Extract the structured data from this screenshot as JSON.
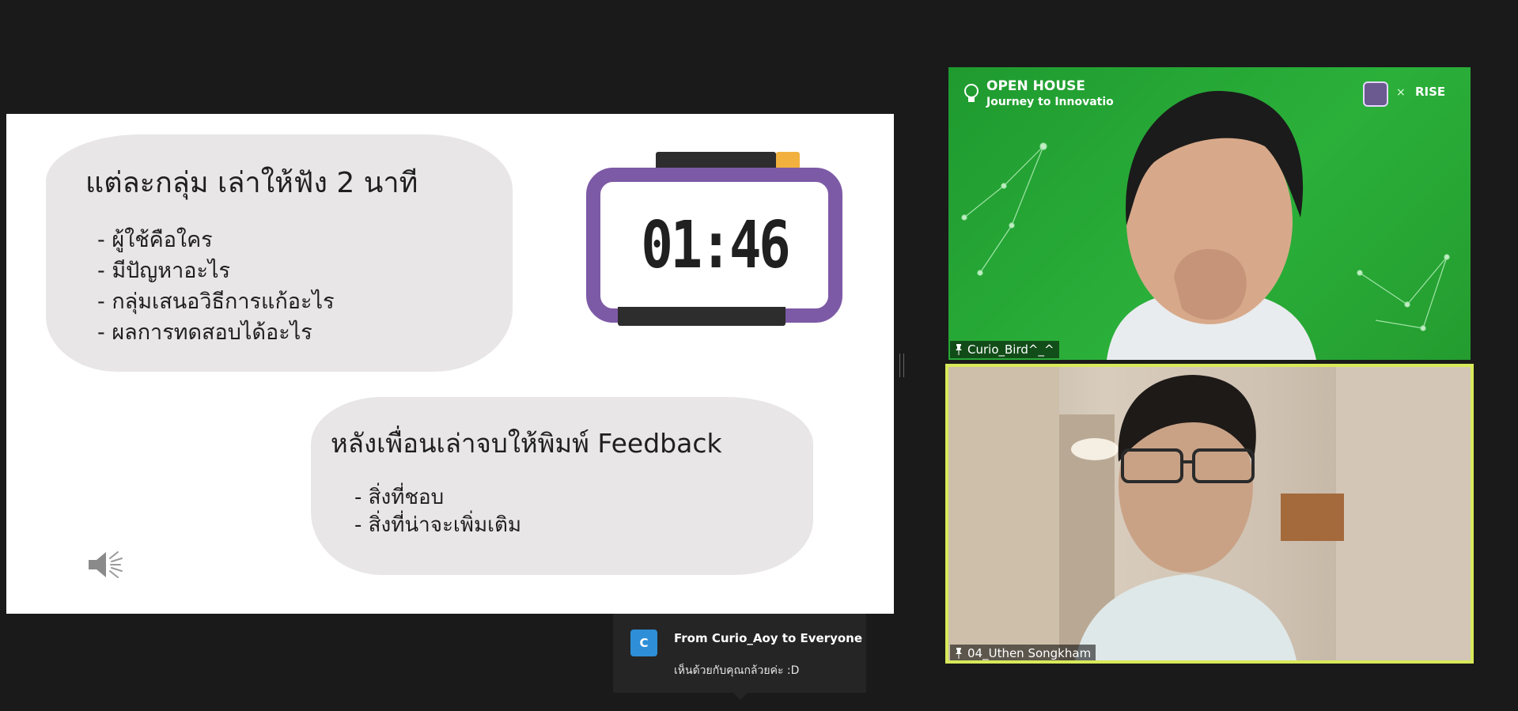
{
  "slide": {
    "heading1": "แต่ละกลุ่ม เล่าให้ฟัง 2 นาที",
    "bullets1": [
      "- ผู้ใช้คือใคร",
      "- มีปัญหาอะไร",
      "- กลุ่มเสนอวิธีการแก้อะไร",
      "- ผลการทดสอบได้อะไร"
    ],
    "heading2": "หลังเพื่อนเล่าจบให้พิมพ์ Feedback",
    "bullets2": [
      "- สิ่งที่ชอบ",
      "- สิ่งที่น่าจะเพิ่มเติม"
    ],
    "timer": "01:46",
    "timer_color": "#7d5aa6",
    "speaker_icon": "speaker-icon"
  },
  "videos": [
    {
      "name": "Curio_Bird^_^",
      "background_title": "OPEN HOUSE",
      "background_subtitle": "Journey to Innovatio",
      "background_logo": "RISE",
      "background_x": "×",
      "background_color": "#2bb03a"
    },
    {
      "name": "04_Uthen Songkham",
      "active_speaker_border": "#d8ea5a"
    }
  ],
  "chat_toast": {
    "avatar_letter": "C",
    "from": "From Curio_Aoy to Everyone",
    "message": "เห็นด้วยกับคุณกล้วยค่ะ :D"
  }
}
